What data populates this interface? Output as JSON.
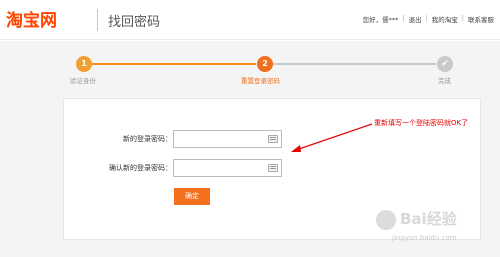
{
  "header": {
    "logo": "淘宝网",
    "title": "找回密码",
    "nav": {
      "greeting": "您好，儒***",
      "logout": "退出",
      "my_taobao": "我的淘宝",
      "help": "联系客服"
    }
  },
  "steps": [
    {
      "number": "1",
      "label": "验证身份",
      "status": "done"
    },
    {
      "number": "2",
      "label": "重置登录密码",
      "status": "current"
    },
    {
      "number": "✔",
      "label": "完成",
      "status": "pending"
    }
  ],
  "form": {
    "new_password_label": "新的登录密码：",
    "new_password_value": "",
    "confirm_password_label": "确认新的登录密码：",
    "confirm_password_value": "",
    "submit_label": "确定"
  },
  "annotation": {
    "text": "重新填写一个登陆密码就OK了"
  },
  "watermark": {
    "text": "Bai经验",
    "sub": "jingyan.baidu.com"
  },
  "colors": {
    "brand": "#ff4400",
    "accent": "#f46f1e",
    "annotation": "#e60000"
  }
}
